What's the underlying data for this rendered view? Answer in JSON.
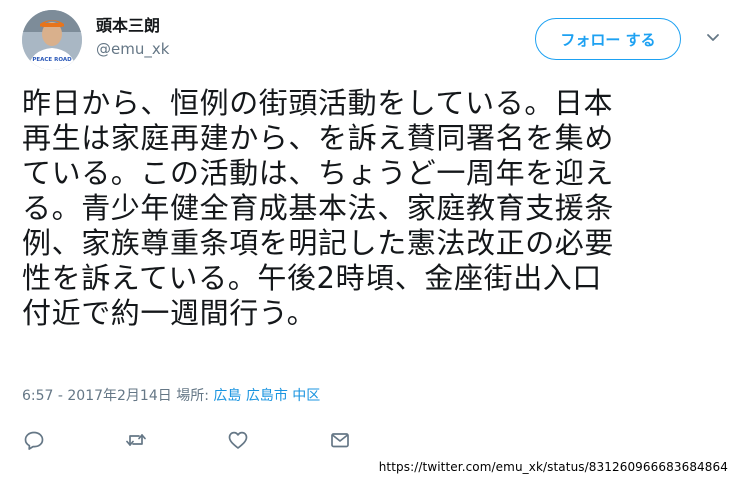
{
  "user": {
    "display_name": "頭本三朗",
    "handle": "@emu_xk",
    "avatar_text": "PEACE ROAD"
  },
  "follow_button": {
    "label": "フォロー する"
  },
  "tweet": {
    "text": "昨日から、恒例の街頭活動をしている。日本\n再生は家庭再建から、を訴え賛同署名を集め\nている。この活動は、ちょうど一周年を迎え\nる。青少年健全育成基本法、家庭教育支援条\n例、家族尊重条項を明記した憲法改正の必要\n性を訴えている。午後2時頃、金座街出入口\n付近で約一週間行う。"
  },
  "meta": {
    "timestamp": "6:57 - 2017年2月14日",
    "location_label": "場所:",
    "location": "広島 広島市 中区"
  },
  "actions": {
    "icons": [
      "reply-icon",
      "retweet-icon",
      "like-icon",
      "message-icon"
    ]
  },
  "source_url": "https://twitter.com/emu_xk/status/831260966683684864",
  "colors": {
    "accent": "#1da1f2",
    "link": "#1b95e0",
    "secondary_text": "#657786",
    "primary_text": "#14171a"
  }
}
